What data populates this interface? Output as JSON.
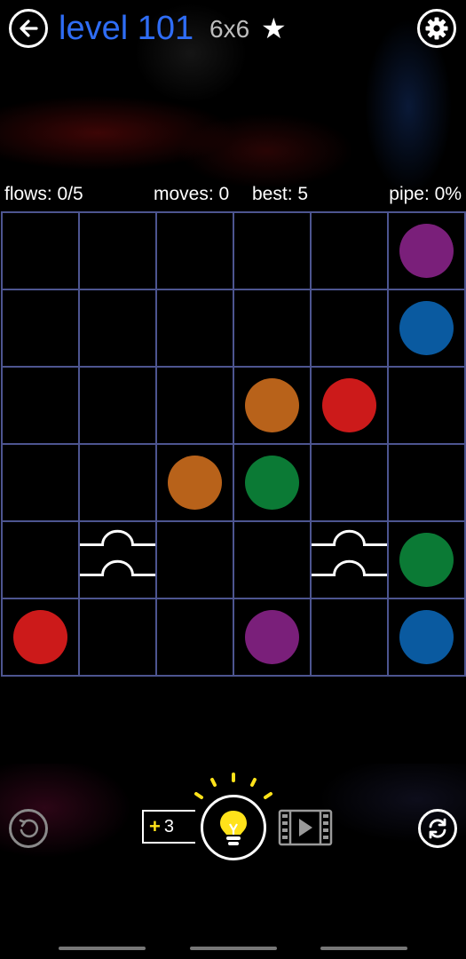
{
  "header": {
    "level_title": "level 101",
    "board_size": "6x6",
    "star": "★",
    "back_icon": "arrow-left-icon",
    "settings_icon": "gear-icon"
  },
  "stats": {
    "flows": "flows: 0/5",
    "moves": "moves: 0",
    "best": "best: 5",
    "pipe": "pipe: 0%"
  },
  "colors": {
    "purple": "#7a1f7a",
    "blue": "#0a5aa0",
    "orange": "#b8621a",
    "red": "#cc1a1a",
    "green": "#0b7a35",
    "grid_line": "#4d5590",
    "title_blue": "#2f6df5",
    "hint_yellow": "#ffe21a"
  },
  "board": {
    "rows": 6,
    "cols": 6,
    "cells": [
      [
        "",
        "",
        "",
        "",
        "",
        "purple"
      ],
      [
        "",
        "",
        "",
        "",
        "",
        "blue"
      ],
      [
        "",
        "",
        "",
        "orange",
        "red",
        ""
      ],
      [
        "",
        "",
        "orange",
        "green",
        "",
        ""
      ],
      [
        "",
        "bridge",
        "",
        "",
        "bridge",
        "green"
      ],
      [
        "red",
        "",
        "",
        "purple",
        "",
        "blue"
      ]
    ]
  },
  "footer": {
    "hint_count": "3",
    "hint_plus": "+",
    "undo_icon": "undo-icon",
    "hint_icon": "lightbulb-icon",
    "video_icon": "video-film-icon",
    "reset_icon": "refresh-icon"
  }
}
